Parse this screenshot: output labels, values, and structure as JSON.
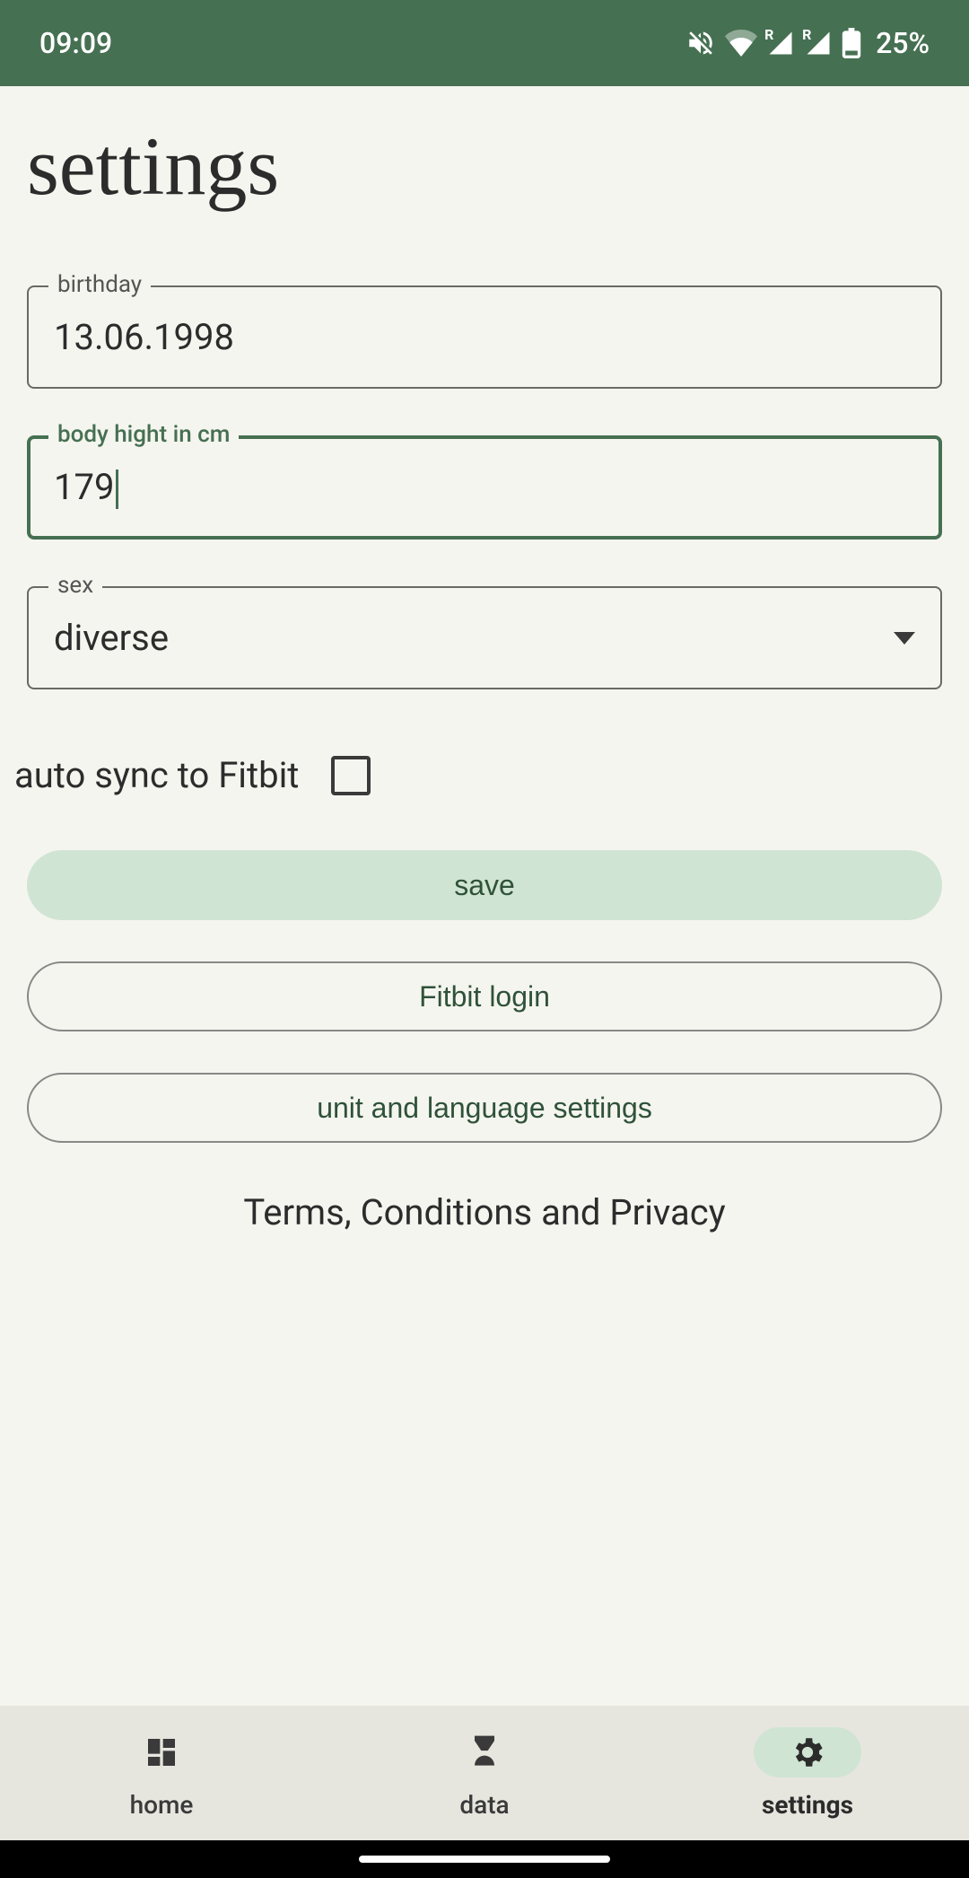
{
  "status": {
    "time": "09:09",
    "battery": "25%"
  },
  "title": "settings",
  "fields": {
    "birthday": {
      "label": "birthday",
      "value": "13.06.1998"
    },
    "height": {
      "label": "body hight in cm",
      "value": "179"
    },
    "sex": {
      "label": "sex",
      "value": "diverse"
    }
  },
  "autosync": {
    "label": "auto sync to Fitbit",
    "checked": false
  },
  "buttons": {
    "save": "save",
    "fitbit": "Fitbit login",
    "unit": "unit and language settings"
  },
  "terms": "Terms, Conditions and Privacy",
  "nav": {
    "home": "home",
    "data": "data",
    "settings": "settings",
    "active": "settings"
  }
}
